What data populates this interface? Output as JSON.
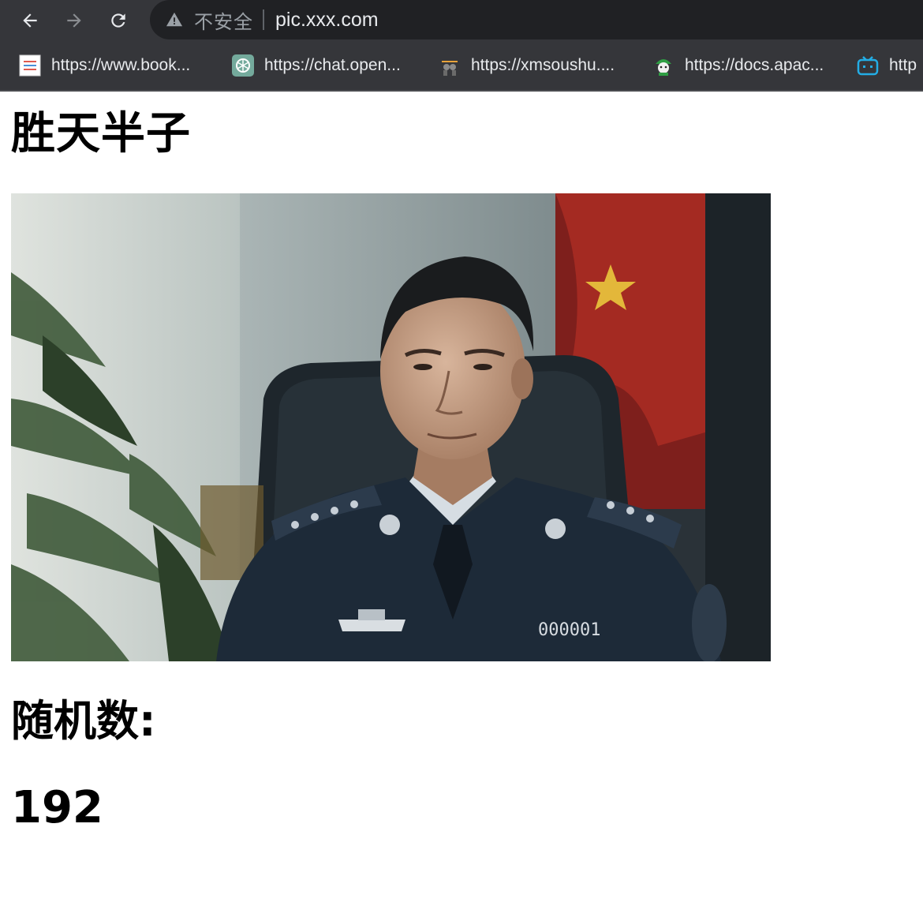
{
  "browser": {
    "security_text": "不安全",
    "url": "pic.xxx.com",
    "bookmarks": [
      {
        "label": "https://www.book...",
        "icon": "book-icon"
      },
      {
        "label": "https://chat.open...",
        "icon": "openai-icon"
      },
      {
        "label": "https://xmsoushu....",
        "icon": "owl-icon"
      },
      {
        "label": "https://docs.apac...",
        "icon": "soldier-icon"
      },
      {
        "label": "http",
        "icon": "bilibili-icon"
      }
    ]
  },
  "page": {
    "title": "胜天半子",
    "random_label": "随机数:",
    "random_value": "192"
  },
  "photo": {
    "badge_number": "000001"
  }
}
